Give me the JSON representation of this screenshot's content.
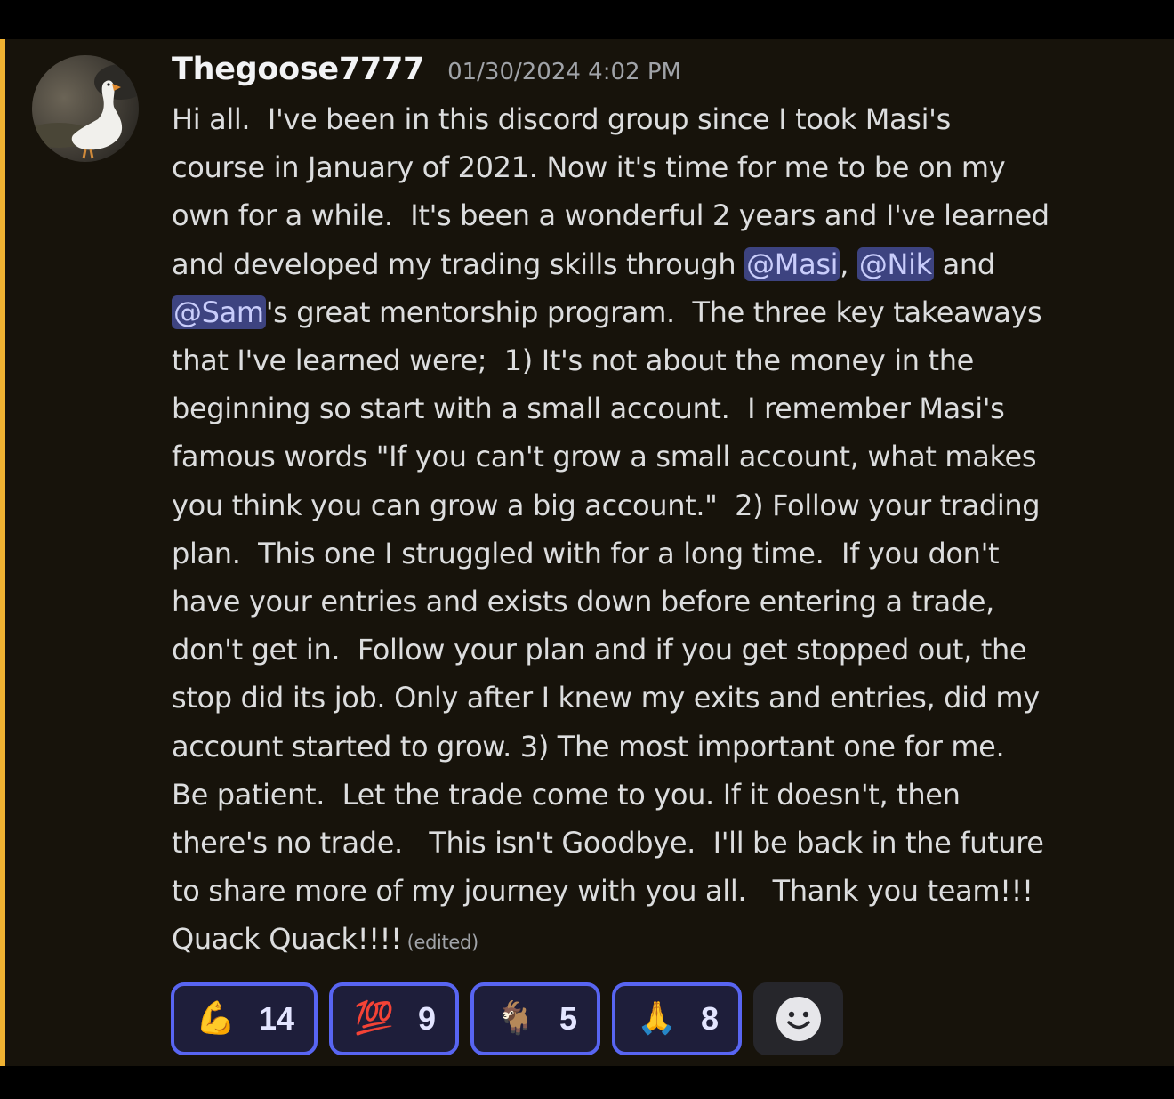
{
  "message": {
    "author": "Thegoose7777",
    "timestamp": "01/30/2024 4:02 PM",
    "avatar_icon": "goose-avatar",
    "highlight_color": "#f0b232",
    "mention_color": "#3d4380",
    "lines": [
      "Hi all.  I've been in this discord group since I took Masi's",
      "course in January of 2021. Now it's time for me to be on my",
      "own for a while.  It's been a wonderful 2 years and I've learned",
      "and developed my trading skills through ",
      "@Masi",
      ", ",
      "@Nik",
      " and",
      "@Sam",
      "'s great mentorship program.  The three key takeaways",
      "that I've learned were;  1) It's not about the money in the",
      "beginning so start with a small account.  I remember Masi's",
      "famous words \"If you can't grow a small account, what makes",
      "you think you can grow a big account.\"  2) Follow your trading",
      "plan.  This one I struggled with for a long time.  If you don't",
      "have your entries and exists down before entering a trade,",
      "don't get in.  Follow your plan and if you get stopped out, the",
      "stop did its job. Only after I knew my exits and entries, did my",
      "account started to grow. 3) The most important one for me.",
      "Be patient.  Let the trade come to you. If it doesn't, then",
      "there's no trade.   This isn't Goodbye.  I'll be back in the future",
      "to share more of my journey with you all.   Thank you team!!!",
      "Quack Quack!!!!"
    ],
    "edited_label": "(edited)"
  },
  "reactions": [
    {
      "emoji": "💪",
      "icon": "flexed-biceps-icon",
      "count": "14"
    },
    {
      "emoji": "💯",
      "icon": "hundred-points-icon",
      "count": "9"
    },
    {
      "emoji": "🐐",
      "icon": "goat-icon",
      "count": "5"
    },
    {
      "emoji": "🙏",
      "icon": "folded-hands-icon",
      "count": "8"
    }
  ],
  "add_reaction_icon": "add-reaction-smiley-icon"
}
